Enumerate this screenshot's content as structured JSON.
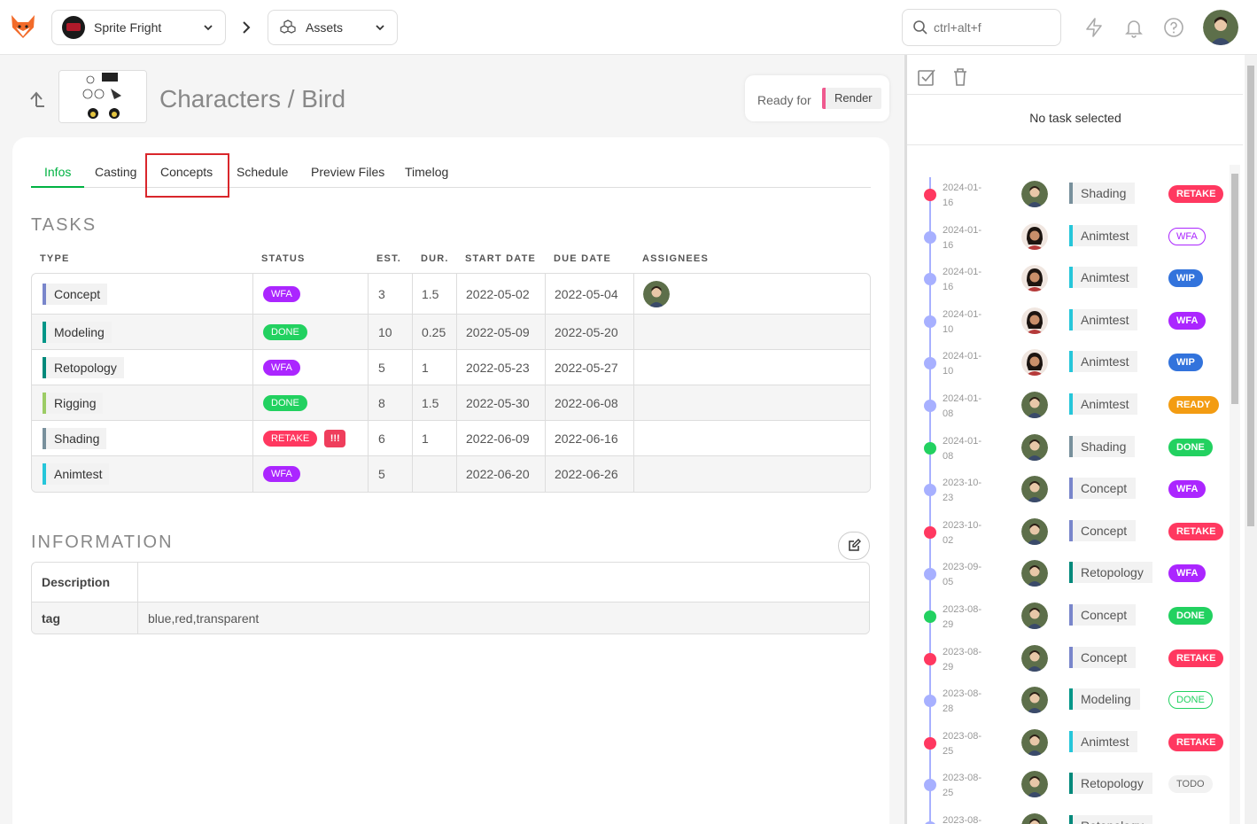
{
  "header": {
    "production": "Sprite Fright",
    "section": "Assets",
    "search_placeholder": "ctrl+alt+f"
  },
  "asset": {
    "title": "Characters / Bird",
    "ready_for_label": "Ready for",
    "ready_for_value": "Render"
  },
  "tabs": [
    {
      "label": "Infos",
      "active": true
    },
    {
      "label": "Casting",
      "active": false
    },
    {
      "label": "Concepts",
      "active": false
    },
    {
      "label": "Schedule",
      "active": false
    },
    {
      "label": "Preview Files",
      "active": false
    },
    {
      "label": "Timelog",
      "active": false
    }
  ],
  "tasks": {
    "title": "TASKS",
    "columns": [
      "TYPE",
      "STATUS",
      "EST.",
      "DUR.",
      "START DATE",
      "DUE DATE",
      "ASSIGNEES"
    ],
    "rows": [
      {
        "type": "Concept",
        "type_color": "#7986cb",
        "status": "WFA",
        "status_color": "#ab26ff",
        "est": "3",
        "dur": "1.5",
        "start": "2022-05-02",
        "due": "2022-05-04",
        "has_assignee": true,
        "alert": ""
      },
      {
        "type": "Modeling",
        "type_color": "#009688",
        "status": "DONE",
        "status_color": "#22d160",
        "est": "10",
        "dur": "0.25",
        "start": "2022-05-09",
        "due": "2022-05-20",
        "has_assignee": false,
        "alert": ""
      },
      {
        "type": "Retopology",
        "type_color": "#00897b",
        "status": "WFA",
        "status_color": "#ab26ff",
        "est": "5",
        "dur": "1",
        "start": "2022-05-23",
        "due": "2022-05-27",
        "has_assignee": false,
        "alert": ""
      },
      {
        "type": "Rigging",
        "type_color": "#9ccc65",
        "status": "DONE",
        "status_color": "#22d160",
        "est": "8",
        "dur": "1.5",
        "start": "2022-05-30",
        "due": "2022-06-08",
        "has_assignee": false,
        "alert": ""
      },
      {
        "type": "Shading",
        "type_color": "#78909c",
        "status": "RETAKE",
        "status_color": "#ff3860",
        "est": "6",
        "dur": "1",
        "start": "2022-06-09",
        "due": "2022-06-16",
        "has_assignee": false,
        "alert": "!!!"
      },
      {
        "type": "Animtest",
        "type_color": "#26c6da",
        "status": "WFA",
        "status_color": "#ab26ff",
        "est": "5",
        "dur": "",
        "start": "2022-06-20",
        "due": "2022-06-26",
        "has_assignee": false,
        "alert": ""
      }
    ]
  },
  "information": {
    "title": "INFORMATION",
    "rows": [
      {
        "label": "Description",
        "value": ""
      },
      {
        "label": "tag",
        "value": "blue,red,transparent"
      }
    ]
  },
  "side_panel": {
    "no_task": "No task selected",
    "timeline": [
      {
        "date": "2024-01-16",
        "type": "Shading",
        "type_color": "#78909c",
        "status": "RETAKE",
        "status_color": "#ff3860",
        "dot_color": "#ff3860",
        "avatar": "a",
        "outline": false
      },
      {
        "date": "2024-01-16",
        "type": "Animtest",
        "type_color": "#26c6da",
        "status": "WFA",
        "status_color": "#ab26ff",
        "dot_color": "#a7b0ff",
        "avatar": "b",
        "outline": true
      },
      {
        "date": "2024-01-16",
        "type": "Animtest",
        "type_color": "#26c6da",
        "status": "WIP",
        "status_color": "#3273dc",
        "dot_color": "#a7b0ff",
        "avatar": "b",
        "outline": false
      },
      {
        "date": "2024-01-10",
        "type": "Animtest",
        "type_color": "#26c6da",
        "status": "WFA",
        "status_color": "#ab26ff",
        "dot_color": "#a7b0ff",
        "avatar": "b",
        "outline": false
      },
      {
        "date": "2024-01-10",
        "type": "Animtest",
        "type_color": "#26c6da",
        "status": "WIP",
        "status_color": "#3273dc",
        "dot_color": "#a7b0ff",
        "avatar": "b",
        "outline": false
      },
      {
        "date": "2024-01-08",
        "type": "Animtest",
        "type_color": "#26c6da",
        "status": "READY",
        "status_color": "#f39c12",
        "dot_color": "#a7b0ff",
        "avatar": "a",
        "outline": false
      },
      {
        "date": "2024-01-08",
        "type": "Shading",
        "type_color": "#78909c",
        "status": "DONE",
        "status_color": "#22d160",
        "dot_color": "#22d160",
        "avatar": "a",
        "outline": false
      },
      {
        "date": "2023-10-23",
        "type": "Concept",
        "type_color": "#7986cb",
        "status": "WFA",
        "status_color": "#ab26ff",
        "dot_color": "#a7b0ff",
        "avatar": "a",
        "outline": false
      },
      {
        "date": "2023-10-02",
        "type": "Concept",
        "type_color": "#7986cb",
        "status": "RETAKE",
        "status_color": "#ff3860",
        "dot_color": "#ff3860",
        "avatar": "a",
        "outline": false
      },
      {
        "date": "2023-09-05",
        "type": "Retopology",
        "type_color": "#00897b",
        "status": "WFA",
        "status_color": "#ab26ff",
        "dot_color": "#a7b0ff",
        "avatar": "a",
        "outline": false
      },
      {
        "date": "2023-08-29",
        "type": "Concept",
        "type_color": "#7986cb",
        "status": "DONE",
        "status_color": "#22d160",
        "dot_color": "#22d160",
        "avatar": "a",
        "outline": false
      },
      {
        "date": "2023-08-29",
        "type": "Concept",
        "type_color": "#7986cb",
        "status": "RETAKE",
        "status_color": "#ff3860",
        "dot_color": "#ff3860",
        "avatar": "a",
        "outline": false
      },
      {
        "date": "2023-08-28",
        "type": "Modeling",
        "type_color": "#009688",
        "status": "DONE",
        "status_color": "#22d160",
        "dot_color": "#a7b0ff",
        "avatar": "a",
        "outline": true
      },
      {
        "date": "2023-08-25",
        "type": "Animtest",
        "type_color": "#26c6da",
        "status": "RETAKE",
        "status_color": "#ff3860",
        "dot_color": "#ff3860",
        "avatar": "a",
        "outline": false
      },
      {
        "date": "2023-08-25",
        "type": "Retopology",
        "type_color": "#00897b",
        "status": "TODO",
        "status_color": "#f2f2f2",
        "dot_color": "#a7b0ff",
        "avatar": "a",
        "outline": false
      },
      {
        "date": "2023-08-",
        "type": "Retopology",
        "type_color": "#00897b",
        "status": "",
        "status_color": "#f2f2f2",
        "dot_color": "#a7b0ff",
        "avatar": "a",
        "outline": false
      }
    ]
  }
}
